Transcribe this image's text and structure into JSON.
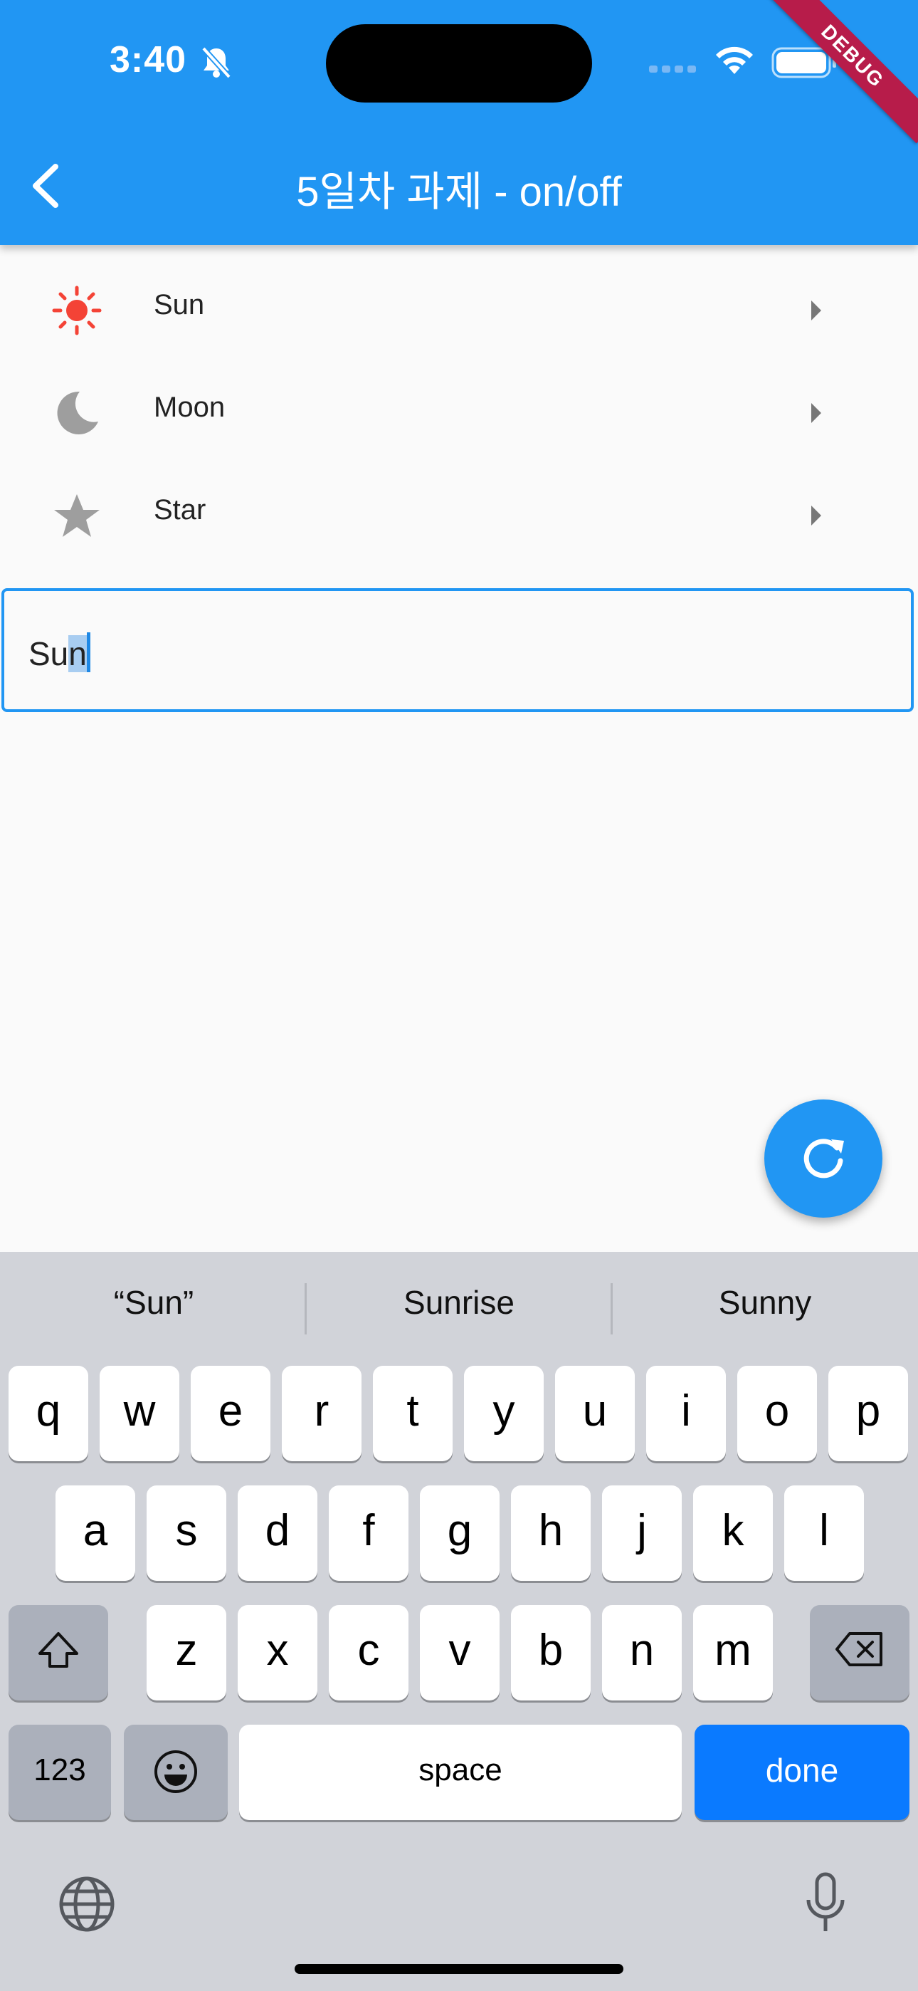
{
  "status_bar": {
    "time": "3:40"
  },
  "debug_banner": "DEBUG",
  "app_bar": {
    "title": "5일차 과제 - on/off"
  },
  "list": [
    {
      "label": "Sun",
      "icon": "sun-icon",
      "icon_color": "#f44336"
    },
    {
      "label": "Moon",
      "icon": "moon-icon",
      "icon_color": "#9e9e9e"
    },
    {
      "label": "Star",
      "icon": "star-icon",
      "icon_color": "#9e9e9e"
    }
  ],
  "text_field": {
    "value_start": "Su",
    "value_selected": "n"
  },
  "fab": {
    "icon": "refresh-icon"
  },
  "keyboard": {
    "suggestions": [
      "“Sun”",
      "Sunrise",
      "Sunny"
    ],
    "row1": [
      "q",
      "w",
      "e",
      "r",
      "t",
      "y",
      "u",
      "i",
      "o",
      "p"
    ],
    "row2": [
      "a",
      "s",
      "d",
      "f",
      "g",
      "h",
      "j",
      "k",
      "l"
    ],
    "row3": [
      "z",
      "x",
      "c",
      "v",
      "b",
      "n",
      "m"
    ],
    "numbers_key": "123",
    "space_key": "space",
    "done_key": "done"
  },
  "colors": {
    "primary": "#2196f3",
    "done_key": "#0a7aff"
  }
}
